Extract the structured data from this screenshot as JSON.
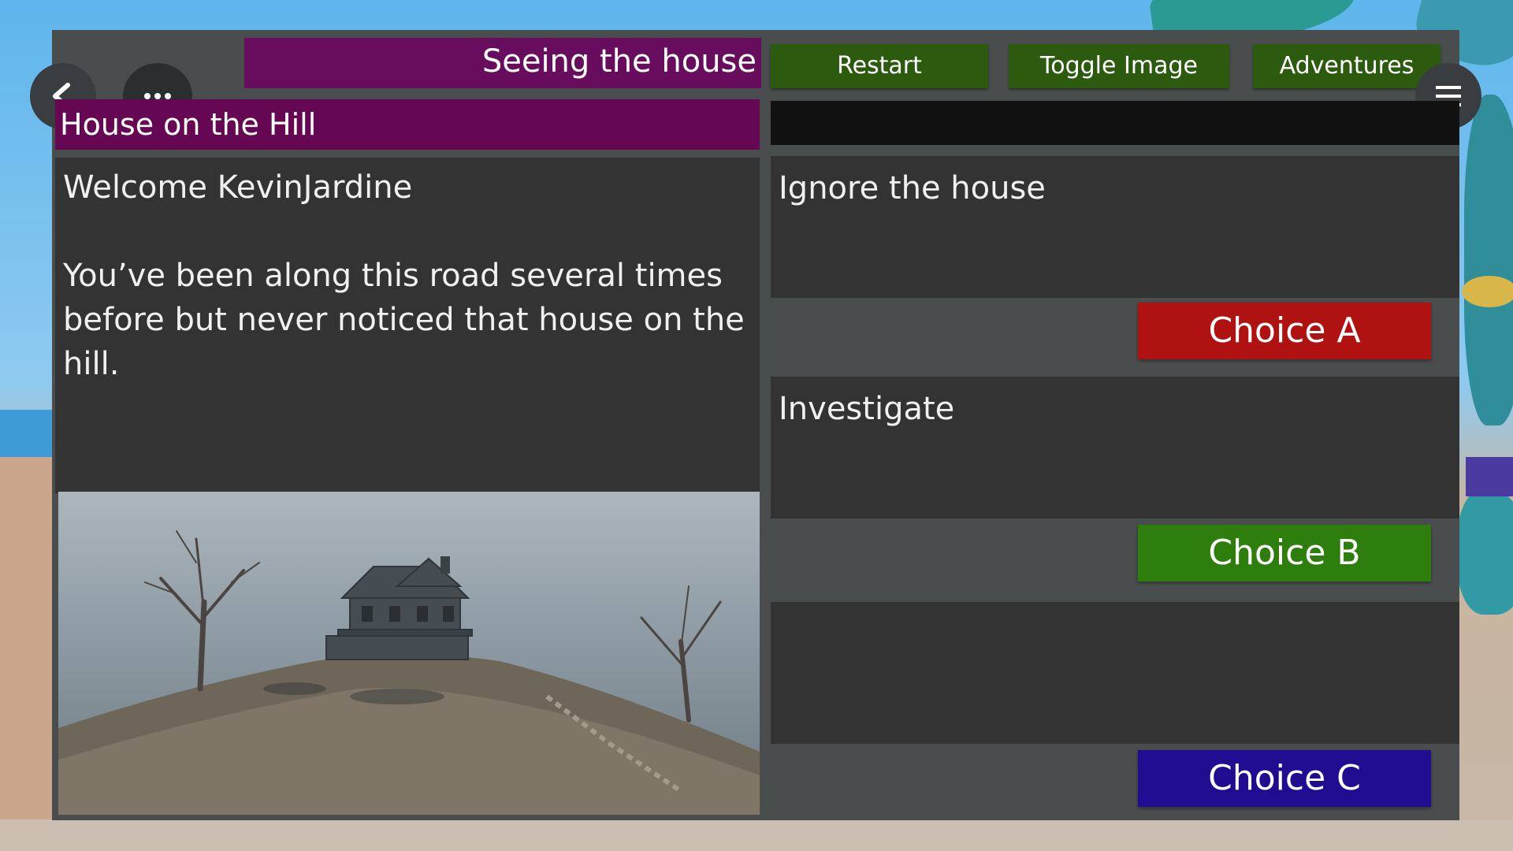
{
  "header": {
    "scene_title": "Seeing the house",
    "buttons": {
      "restart": "Restart",
      "toggle_image": "Toggle Image",
      "adventures": "Adventures"
    }
  },
  "adventure": {
    "name": "House on the Hill",
    "welcome": "Welcome KevinJardine",
    "story": "You’ve been along this road several times before but never noticed that house on the hill."
  },
  "choices": [
    {
      "text": "Ignore the house",
      "button": "Choice A",
      "color": "#b01212"
    },
    {
      "text": "Investigate",
      "button": "Choice B",
      "color": "#2e7e0e"
    },
    {
      "text": "",
      "button": "Choice C",
      "color": "#1f0c90"
    }
  ],
  "icons": {
    "back": "chevron-left-icon",
    "more": "more-dots-icon",
    "menu": "hamburger-menu-icon"
  },
  "colors": {
    "title_bar": "#680c5e",
    "top_buttons": "#2c5a0e",
    "panel": "#4a4d4e"
  }
}
